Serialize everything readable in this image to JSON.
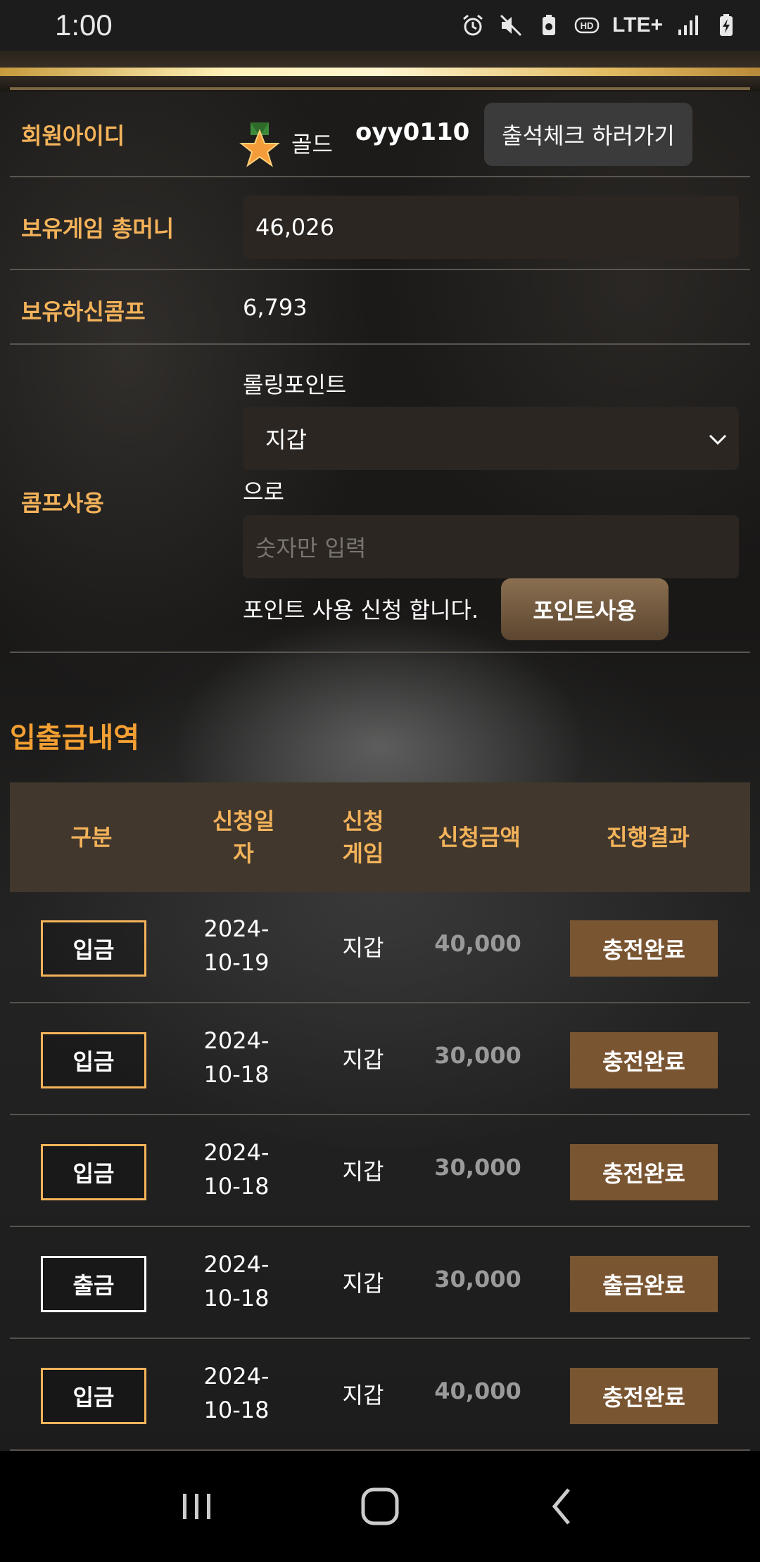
{
  "status_bar": {
    "time": "1:00",
    "icons": [
      "alarm-icon",
      "mute-icon",
      "battery-saver-icon",
      "hd-icon",
      "lte-icon",
      "signal-icon",
      "battery-charging-icon"
    ],
    "network": "LTE+"
  },
  "member": {
    "id_label": "회원아이디",
    "grade": "골드",
    "user_id": "oyy0110",
    "attend_button": "출석체크 하러가기"
  },
  "money": {
    "label": "보유게임 총머니",
    "value": "46,026"
  },
  "comp": {
    "label": "보유하신콤프",
    "value": "6,793"
  },
  "comp_use": {
    "label": "콤프사용",
    "rolling_label": "롤링포인트",
    "select_value": "지갑",
    "to_label": "으로",
    "amount_placeholder": "숫자만 입력",
    "apply_text": "포인트 사용 신청 합니다.",
    "apply_button": "포인트사용"
  },
  "history": {
    "title": "입출금내역",
    "headers": [
      "구분",
      "신청일자",
      "신청게임",
      "신청금액",
      "진행결과"
    ],
    "header_lines": [
      [
        "구분"
      ],
      [
        "신청일",
        "자"
      ],
      [
        "신청",
        "게임"
      ],
      [
        "신청금액"
      ],
      [
        "진행결과"
      ]
    ],
    "rows": [
      {
        "type": "입금",
        "date1": "2024-",
        "date2": "10-19",
        "game": "지갑",
        "amount": "40,000",
        "result": "충전완료"
      },
      {
        "type": "입금",
        "date1": "2024-",
        "date2": "10-18",
        "game": "지갑",
        "amount": "30,000",
        "result": "충전완료"
      },
      {
        "type": "입금",
        "date1": "2024-",
        "date2": "10-18",
        "game": "지갑",
        "amount": "30,000",
        "result": "충전완료"
      },
      {
        "type": "출금",
        "date1": "2024-",
        "date2": "10-18",
        "game": "지갑",
        "amount": "30,000",
        "result": "출금완료"
      },
      {
        "type": "입금",
        "date1": "2024-",
        "date2": "10-18",
        "game": "지갑",
        "amount": "40,000",
        "result": "충전완료"
      }
    ]
  },
  "colors": {
    "accent": "#f4b35a",
    "title_accent": "#f4a033",
    "table_header_bg": "#41372d",
    "result_button_bg": "#7a5532"
  }
}
